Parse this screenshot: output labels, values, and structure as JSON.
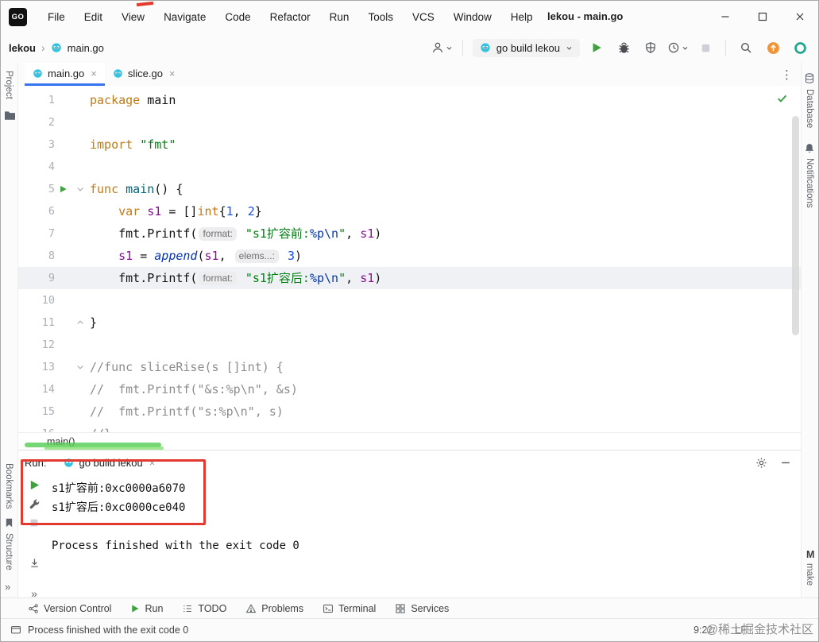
{
  "colors": {
    "accent_blue": "#3574F0",
    "run_green": "#3FA13F",
    "annotation_red": "#E23A2E",
    "annotation_green": "#52CC52",
    "update_orange": "#F09436",
    "gopher_blue": "#35C3E0",
    "keyword_orange": "#C07A18",
    "string_green": "#067D17",
    "number_blue": "#1750EB",
    "variable_purple": "#871094",
    "comment_gray": "#8C8C8C"
  },
  "icons": {
    "close": "×",
    "more": "»",
    "menu_dots": "⋮",
    "crumb_sep": "›"
  },
  "titlebar": {
    "logo": "GO",
    "title": "lekou - main.go",
    "menus": [
      "File",
      "Edit",
      "View",
      "Navigate",
      "Code",
      "Refactor",
      "Run",
      "Tools",
      "VCS",
      "Window",
      "Help"
    ]
  },
  "toolbar": {
    "project": "lekou",
    "file": "main.go",
    "run_config": "go build lekou"
  },
  "tabs": {
    "items": [
      {
        "label": "main.go",
        "active": true
      },
      {
        "label": "slice.go",
        "active": false
      }
    ]
  },
  "stripes": {
    "left": [
      "Project",
      "Bookmarks",
      "Structure"
    ],
    "right": [
      "Database",
      "Notifications",
      "make"
    ],
    "make_letter": "M"
  },
  "editor": {
    "breadcrumb": "main()",
    "lines": [
      {
        "n": 1,
        "seg": [
          [
            "k",
            "package"
          ],
          [
            "p",
            " main"
          ]
        ]
      },
      {
        "n": 2,
        "seg": []
      },
      {
        "n": 3,
        "seg": [
          [
            "k",
            "import"
          ],
          [
            "p",
            " "
          ],
          [
            "s",
            "\"fmt\""
          ]
        ]
      },
      {
        "n": 4,
        "seg": []
      },
      {
        "n": 5,
        "run": true,
        "fold": "down",
        "seg": [
          [
            "k",
            "func"
          ],
          [
            "p",
            " "
          ],
          [
            "f",
            "main"
          ],
          [
            "p",
            "() {"
          ]
        ]
      },
      {
        "n": 6,
        "seg": [
          [
            "p",
            "    "
          ],
          [
            "k",
            "var"
          ],
          [
            "p",
            " "
          ],
          [
            "v",
            "s1"
          ],
          [
            "p",
            " = []"
          ],
          [
            "k",
            "int"
          ],
          [
            "p",
            "{"
          ],
          [
            "num",
            "1"
          ],
          [
            "p",
            ", "
          ],
          [
            "num",
            "2"
          ],
          [
            "p",
            "}"
          ]
        ]
      },
      {
        "n": 7,
        "seg": [
          [
            "p",
            "    fmt.Printf("
          ],
          [
            "h",
            "format:"
          ],
          [
            "s",
            " \"s1扩容前:"
          ],
          [
            "e",
            "%p\\n"
          ],
          [
            "s",
            "\""
          ],
          [
            "p",
            ", "
          ],
          [
            "v",
            "s1"
          ],
          [
            "p",
            ")"
          ]
        ]
      },
      {
        "n": 8,
        "seg": [
          [
            "p",
            "    "
          ],
          [
            "v",
            "s1"
          ],
          [
            "p",
            " = "
          ],
          [
            "b",
            "append"
          ],
          [
            "p",
            "("
          ],
          [
            "v",
            "s1"
          ],
          [
            "p",
            ", "
          ],
          [
            "h",
            "elems...:"
          ],
          [
            "num",
            " 3"
          ],
          [
            "p",
            ")"
          ]
        ]
      },
      {
        "n": 9,
        "hl": true,
        "seg": [
          [
            "p",
            "    fmt.Printf("
          ],
          [
            "h",
            "format:"
          ],
          [
            "s",
            " \"s1扩容后:"
          ],
          [
            "e",
            "%p\\n"
          ],
          [
            "s",
            "\""
          ],
          [
            "p",
            ", "
          ],
          [
            "v",
            "s1"
          ],
          [
            "p",
            ")"
          ]
        ]
      },
      {
        "n": 10,
        "seg": []
      },
      {
        "n": 11,
        "fold": "up",
        "seg": [
          [
            "p",
            "}"
          ]
        ]
      },
      {
        "n": 12,
        "seg": []
      },
      {
        "n": 13,
        "fold": "down",
        "seg": [
          [
            "c",
            "//func sliceRise(s []int) {"
          ]
        ]
      },
      {
        "n": 14,
        "seg": [
          [
            "c",
            "//  fmt.Printf(\"&s:%p\\n\", &s)"
          ]
        ]
      },
      {
        "n": 15,
        "seg": [
          [
            "c",
            "//  fmt.Printf(\"s:%p\\n\", s)"
          ]
        ]
      },
      {
        "n": 16,
        "seg": [
          [
            "c",
            "//}"
          ]
        ]
      }
    ]
  },
  "run_panel": {
    "label": "Run:",
    "tab": "go build lekou",
    "output": [
      "s1扩容前:0xc0000a6070",
      "s1扩容后:0xc0000ce040",
      "",
      "Process finished with the exit code 0"
    ]
  },
  "toolwindow_bar": {
    "items": [
      "Version Control",
      "Run",
      "TODO",
      "Problems",
      "Terminal",
      "Services"
    ]
  },
  "statusbar": {
    "message": "Process finished with the exit code 0",
    "caret": "9:22",
    "line_separator": "LF"
  },
  "watermark": "@稀土掘金技术社区"
}
